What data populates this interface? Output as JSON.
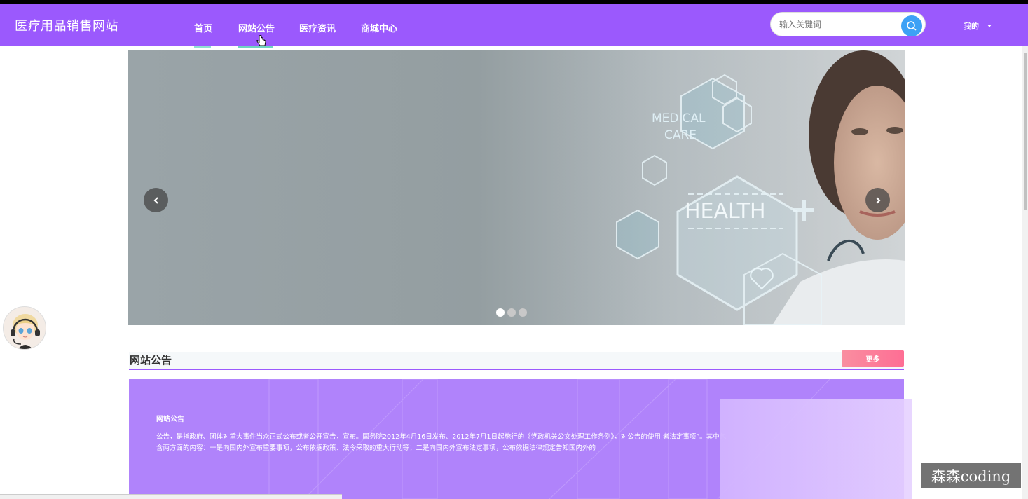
{
  "brand": "医疗用品销售网站",
  "nav": {
    "items": [
      {
        "label": "首页"
      },
      {
        "label": "网站公告"
      },
      {
        "label": "医疗资讯"
      },
      {
        "label": "商城中心"
      }
    ],
    "active_index": 1
  },
  "search": {
    "placeholder": "输入关键词"
  },
  "user_menu": {
    "label": "我的"
  },
  "carousel": {
    "prev_icon": "chevron-left-icon",
    "next_icon": "chevron-right-icon",
    "slide_text": {
      "medical": "MEDICAL",
      "care": "CARE",
      "health": "HEALTH"
    },
    "slide_count": 3,
    "active_slide": 0
  },
  "announcements": {
    "section_title": "网站公告",
    "more_label": "更多",
    "card_title": "网站公告",
    "card_body": "公告，是指政府、团体对重大事件当众正式公布或者公开宣告，宣布。国务院2012年4月16日发布、2012年7月1日起施行的《党政机关公文处理工作条例》，对公告的使用 者法定事项”。其中包含两方面的内容：一是向国内外宣布重要事项，公布依据政策、法令采取的重大行动等；二是向国内外宣布法定事项，公布依据法律规定告知国内外的"
  },
  "watermark": "森森coding",
  "colors": {
    "navbar": "#9b59fd",
    "accent_underline": "#6fd3c2",
    "search_button": "#3da1f5",
    "more_button": "#fe6e94",
    "notice_card": "#b083fb"
  }
}
